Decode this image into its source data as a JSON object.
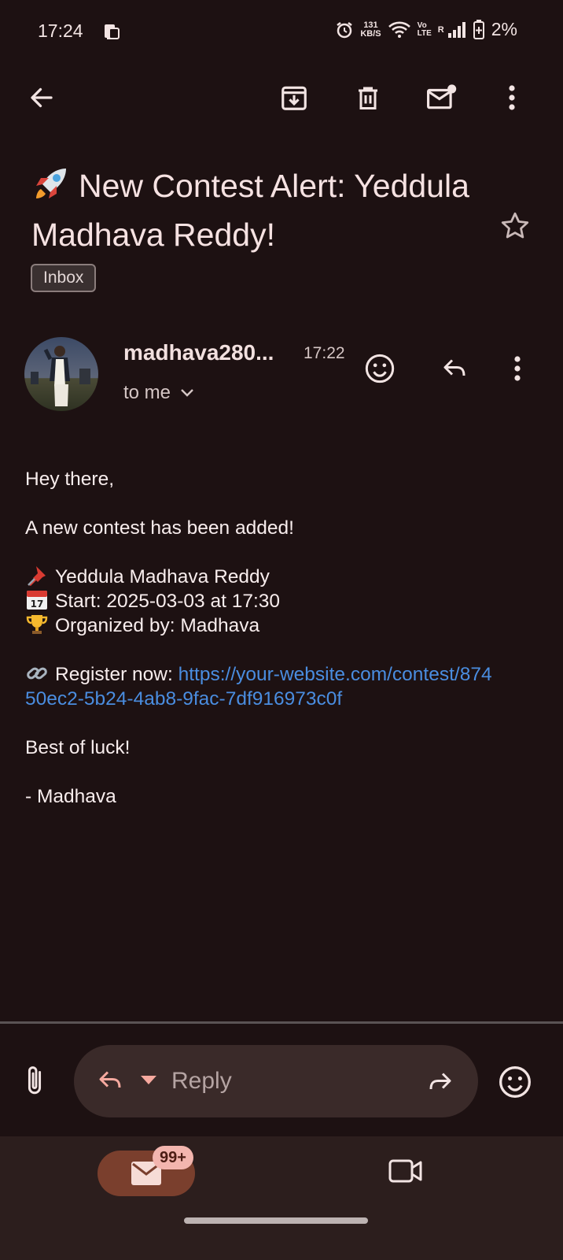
{
  "status_bar": {
    "time": "17:24",
    "net_speed_value": "131",
    "net_speed_unit": "KB/S",
    "volte_top": "Vo",
    "volte_bottom": "LTE",
    "roaming": "R",
    "battery": "2%",
    "icons": [
      "device-icon",
      "alarm-icon",
      "wifi-icon",
      "signal-icon",
      "battery-icon"
    ]
  },
  "toolbar": {
    "icons": [
      "back-arrow-icon",
      "archive-icon",
      "delete-icon",
      "mark-unread-icon",
      "more-vert-icon"
    ]
  },
  "email": {
    "subject": "New Contest Alert: Yeddula Madhava Reddy!",
    "subject_icon": "rocket-icon",
    "label": "Inbox",
    "sender": "madhava280...",
    "time": "17:22",
    "recipient": "to me",
    "body": {
      "greeting": "Hey there,",
      "intro": "A new contest has been added!",
      "title_line": "Yeddula Madhava Reddy",
      "start_line": "Start: 2025-03-03 at 17:30",
      "organizer_line": "Organized by: Madhava",
      "register_label": "Register now: ",
      "register_link": "https://your-website.com/contest/87450ec2-5b24-4ab8-9fac-7df916973c0f",
      "closing": "Best of luck!",
      "signature": "- Madhava"
    }
  },
  "reply_bar": {
    "placeholder": "Reply"
  },
  "bottom_nav": {
    "mail_badge": "99+"
  },
  "colors": {
    "background": "#1d1112",
    "link": "#4a8de0",
    "badge": "#f3b5ae",
    "mail_pill": "#7a3f2d"
  }
}
